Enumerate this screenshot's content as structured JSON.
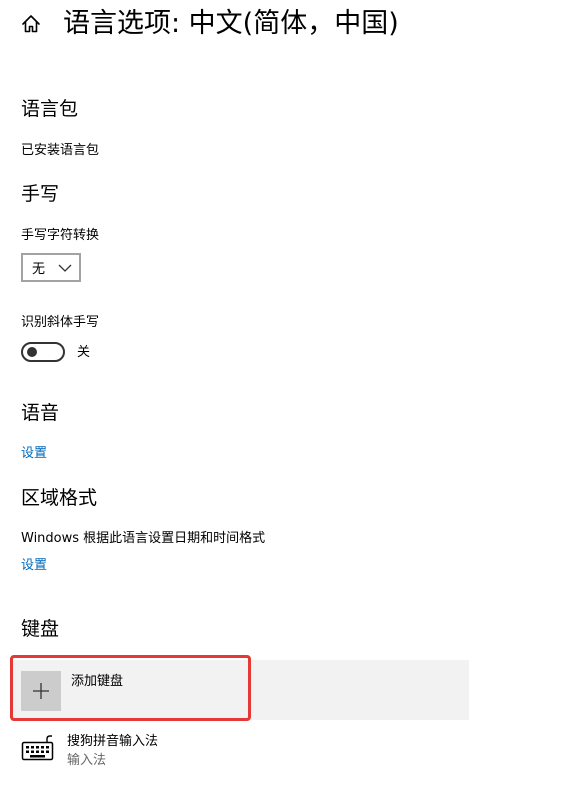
{
  "header": {
    "title": "语言选项: 中文(简体，中国)"
  },
  "language_pack": {
    "title": "语言包",
    "status": "已安装语言包"
  },
  "handwriting": {
    "title": "手写",
    "conversion_label": "手写字符转换",
    "conversion_value": "无",
    "italic_label": "识别斜体手写",
    "italic_toggle_state": "关",
    "italic_toggle_on": false
  },
  "speech": {
    "title": "语音",
    "settings_link": "设置"
  },
  "regional_format": {
    "title": "区域格式",
    "description": "Windows 根据此语言设置日期和时间格式",
    "settings_link": "设置"
  },
  "keyboard": {
    "title": "键盘",
    "add_label": "添加键盘",
    "items": [
      {
        "name": "搜狗拼音输入法",
        "type": "输入法"
      }
    ]
  },
  "colors": {
    "link": "#0067b8",
    "highlight": "#e53935",
    "row_bg": "#f2f2f2",
    "tile_bg": "#cccccc"
  }
}
